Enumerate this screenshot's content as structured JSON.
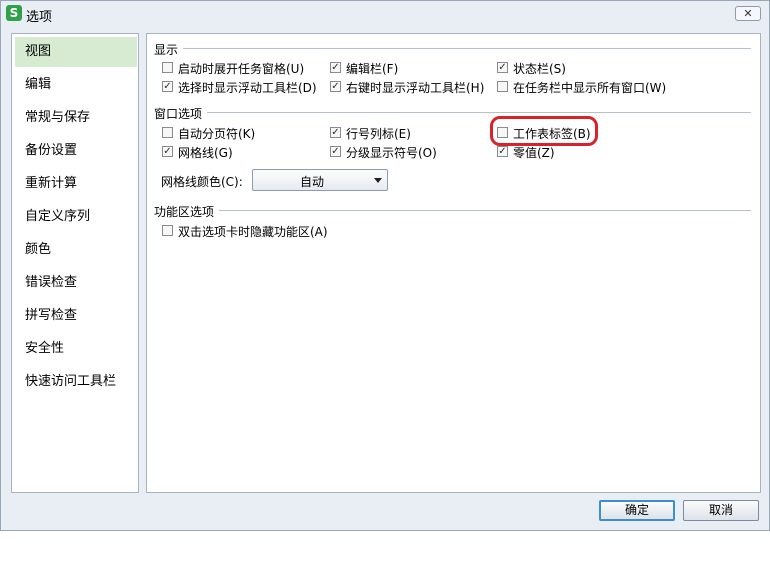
{
  "window": {
    "app_icon": "S",
    "title": "选项",
    "close_label": "✕"
  },
  "sidebar": {
    "items": [
      {
        "label": "视图",
        "selected": true
      },
      {
        "label": "编辑"
      },
      {
        "label": "常规与保存"
      },
      {
        "label": "备份设置"
      },
      {
        "label": "重新计算"
      },
      {
        "label": "自定义序列"
      },
      {
        "label": "颜色"
      },
      {
        "label": "错误检查"
      },
      {
        "label": "拼写检查"
      },
      {
        "label": "安全性"
      },
      {
        "label": "快速访问工具栏"
      }
    ]
  },
  "sections": {
    "display": {
      "title": "显示",
      "options": [
        {
          "label": "启动时展开任务窗格(U)",
          "checked": false
        },
        {
          "label": "编辑栏(F)",
          "checked": true
        },
        {
          "label": "状态栏(S)",
          "checked": true
        },
        {
          "label": "选择时显示浮动工具栏(D)",
          "checked": true
        },
        {
          "label": "右键时显示浮动工具栏(H)",
          "checked": true
        },
        {
          "label": "在任务栏中显示所有窗口(W)",
          "checked": false
        }
      ]
    },
    "window": {
      "title": "窗口选项",
      "options": [
        {
          "label": "自动分页符(K)",
          "checked": false
        },
        {
          "label": "行号列标(E)",
          "checked": true
        },
        {
          "label": "工作表标签(B)",
          "checked": false
        },
        {
          "label": "网格线(G)",
          "checked": true
        },
        {
          "label": "分级显示符号(O)",
          "checked": true
        },
        {
          "label": "零值(Z)",
          "checked": true
        }
      ],
      "gridline_color_label": "网格线颜色(C):",
      "gridline_color_value": "自动"
    },
    "ribbon": {
      "title": "功能区选项",
      "options": [
        {
          "label": "双击选项卡时隐藏功能区(A)",
          "checked": false
        }
      ]
    }
  },
  "footer": {
    "ok_label": "确定",
    "cancel_label": "取消"
  },
  "colors": {
    "dialog_bg": "#e9eef5",
    "selected_nav_bg": "#d6ebd2",
    "highlight_ring": "#d8232a",
    "primary_button_border": "#3b8fd0"
  }
}
